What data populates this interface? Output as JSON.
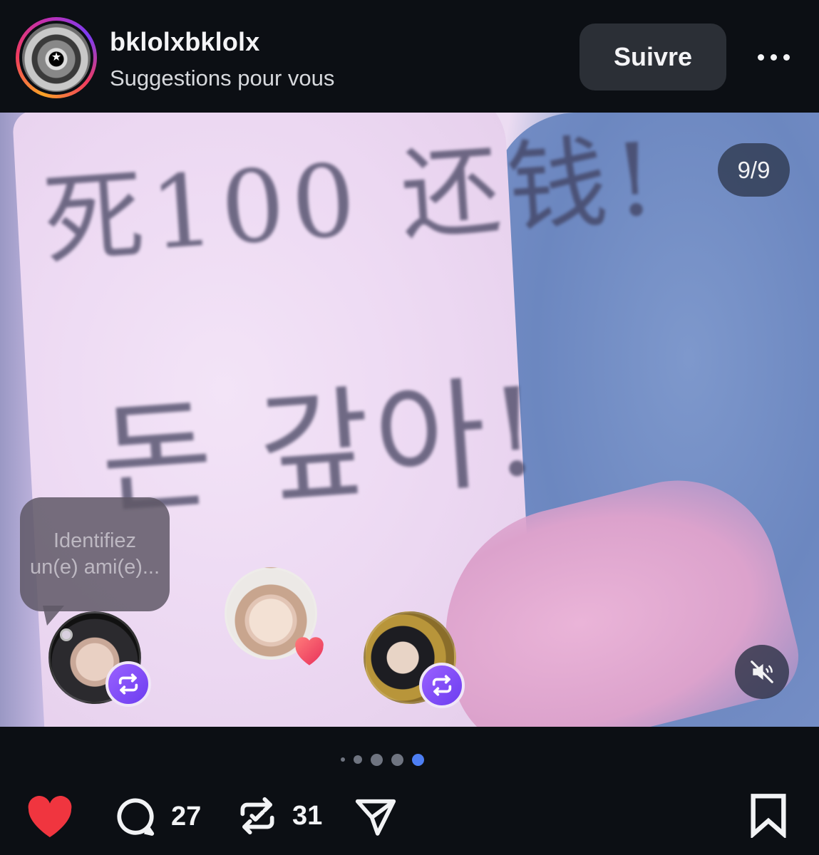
{
  "post": {
    "username": "bklolxbklolx",
    "subtitle": "Suggestions pour vous",
    "follow_label": "Suivre",
    "more_icon": "more-horizontal-icon"
  },
  "media": {
    "counter": "9/9",
    "handwriting_line1": "死100 还钱!",
    "handwriting_line2": "돈 갚아!",
    "tag_prompt": "Identifiez un(e) ami(e)...",
    "mute_icon": "speaker-muted-icon",
    "pager": {
      "total": 5,
      "active_index": 4
    }
  },
  "actions": {
    "like_icon": "heart-filled-icon",
    "comment_icon": "comment-icon",
    "comment_count": "27",
    "repost_icon": "repost-icon",
    "repost_count": "31",
    "share_icon": "send-icon",
    "save_icon": "bookmark-icon"
  },
  "colors": {
    "background": "#0c0f14",
    "follow_button": "#2b2f36",
    "like_red": "#f0353f",
    "repost_purple": "#7b45f6",
    "pager_active": "#4d7ef3"
  }
}
